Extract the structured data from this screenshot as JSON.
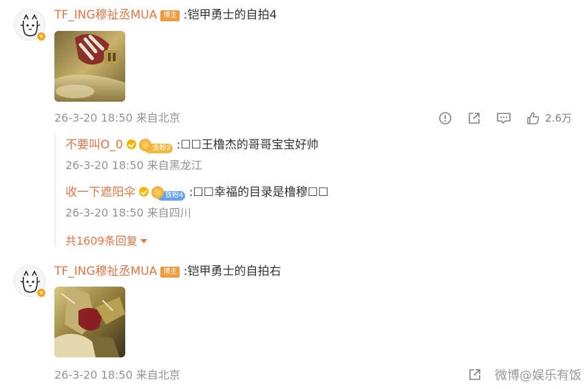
{
  "comments": [
    {
      "username": "TF_ING穆祉丞MUA",
      "badge": "博主",
      "text": ":铠甲勇士的自拍4",
      "meta": "26-3-20 18:50 来自北京",
      "likes": "2.6万",
      "replies": [
        {
          "username": "不要叫O_0",
          "fan_badge": "金粉2",
          "fan_color": "#f5b63a",
          "text": ":☐☐王橹杰的哥哥宝宝好帅",
          "meta": "26-3-20 18:50 来自黑龙江"
        },
        {
          "username": "收一下遮阳伞",
          "fan_badge": "铁粉4",
          "fan_color": "#6aa2e8",
          "text": ":☐☐幸福的目录是橹穆☐☐",
          "meta": "26-3-20 18:50 来自四川"
        }
      ],
      "more_replies": "共1609条回复"
    },
    {
      "username": "TF_ING穆祉丞MUA",
      "badge": "博主",
      "text": ":铠甲勇士的自拍右",
      "meta": "26-3-20 18:50 来自北京"
    }
  ],
  "icons": {
    "report": "report-icon",
    "share": "share-icon",
    "comment": "comment-icon",
    "like": "like-icon"
  },
  "watermark": "微博@娱乐有饭",
  "colors": {
    "accent": "#eb7340",
    "meta": "#939393",
    "host_badge": "#f29b3e",
    "verified": "#f7a21b"
  }
}
